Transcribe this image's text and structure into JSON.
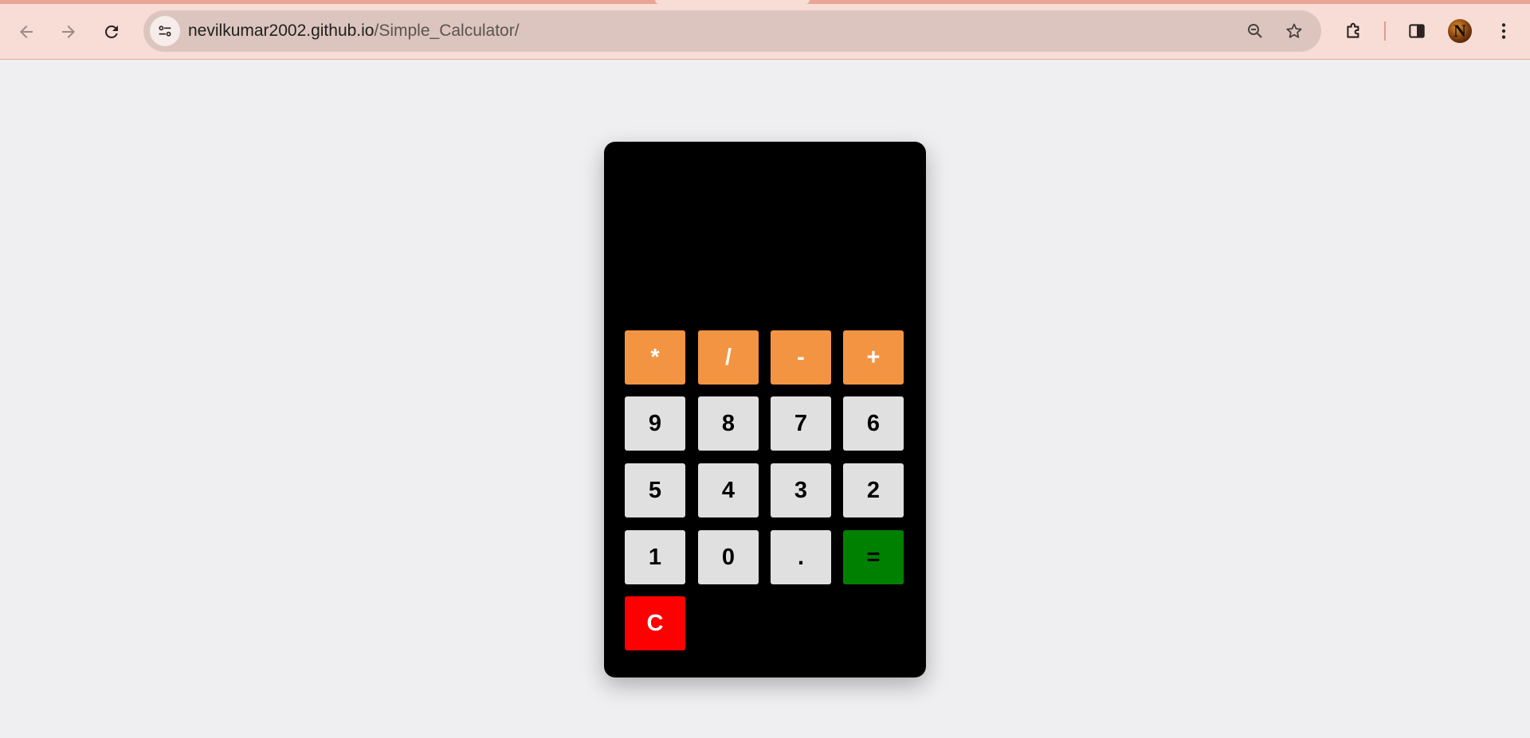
{
  "browser": {
    "url_host": "nevilkumar2002.github.io",
    "url_path": "/Simple_Calculator/",
    "icons": {
      "back": "arrow-left-icon",
      "forward": "arrow-right-icon",
      "reload": "reload-icon",
      "site_info": "tune-icon",
      "zoom": "zoom-out-icon",
      "bookmark": "star-icon",
      "extensions": "puzzle-icon",
      "side_panel": "side-panel-icon",
      "menu": "kebab-menu-icon"
    },
    "avatar_letter": "N",
    "theme_color": "#f8dcd6"
  },
  "calculator": {
    "display_value": "",
    "colors": {
      "body": "#000000",
      "operator": "#f39442",
      "number": "#e0e0e0",
      "equals": "#008000",
      "clear": "#ff0000"
    },
    "operators": [
      "*",
      "/",
      "-",
      "+"
    ],
    "row2": [
      "9",
      "8",
      "7",
      "6"
    ],
    "row3": [
      "5",
      "4",
      "3",
      "2"
    ],
    "row4": [
      "1",
      "0",
      "."
    ],
    "equals_label": "=",
    "clear_label": "C"
  }
}
